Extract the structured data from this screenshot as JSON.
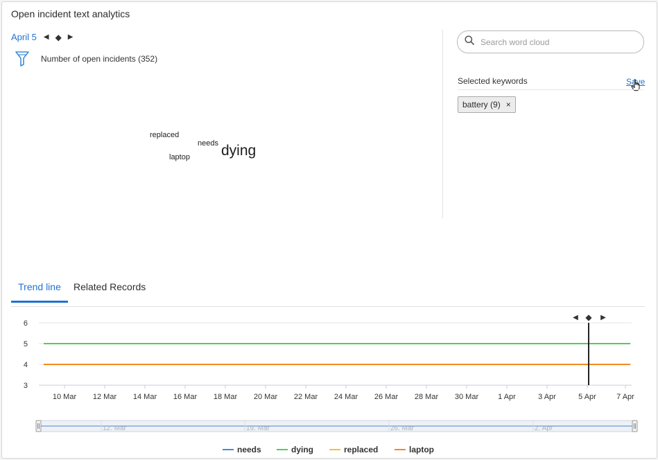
{
  "panel": {
    "title": "Open incident text analytics"
  },
  "date_nav": {
    "label": "April 5",
    "prev_glyph": "◀",
    "center_glyph": "◆",
    "next_glyph": "▶"
  },
  "filter": {
    "label": "Number of open incidents (352)",
    "icon": "filter-icon"
  },
  "word_cloud": {
    "words": {
      "replaced": "replaced",
      "needs": "needs",
      "laptop": "laptop",
      "dying": "dying"
    }
  },
  "search": {
    "placeholder": "Search word cloud",
    "value": ""
  },
  "keywords": {
    "label": "Selected keywords",
    "save_label": "Save",
    "chips": [
      {
        "label": "battery (9)",
        "remove_glyph": "×"
      }
    ]
  },
  "tabs": [
    {
      "label": "Trend line"
    },
    {
      "label": "Related Records"
    }
  ],
  "colors": {
    "accent": "#1f73d1",
    "needs": "#3e8ed8",
    "dying": "#4fcf4f",
    "replaced": "#f7c21c",
    "laptop": "#f28a1e"
  },
  "chart_data": {
    "type": "line",
    "x_tick_labels": [
      "10 Mar",
      "12 Mar",
      "14 Mar",
      "16 Mar",
      "18 Mar",
      "20 Mar",
      "22 Mar",
      "24 Mar",
      "26 Mar",
      "28 Mar",
      "30 Mar",
      "1 Apr",
      "3 Apr",
      "5 Apr",
      "7 Apr"
    ],
    "xlim": [
      "2024-03-08",
      "2024-04-07"
    ],
    "ylim": [
      3,
      6
    ],
    "y_ticks": [
      3,
      4,
      5,
      6
    ],
    "marker_date": "5 Apr",
    "marker_controls": {
      "prev": "◀",
      "center": "◆",
      "next": "▶"
    },
    "series": [
      {
        "name": "needs",
        "color": "#3e8ed8",
        "values": []
      },
      {
        "name": "dying",
        "color": "#4fcf4f",
        "values": [
          [
            "2024-03-08",
            5
          ],
          [
            "2024-04-07",
            5
          ]
        ]
      },
      {
        "name": "replaced",
        "color": "#f7c21c",
        "values": []
      },
      {
        "name": "laptop",
        "color": "#f28a1e",
        "values": [
          [
            "2024-03-08",
            4
          ],
          [
            "2024-04-07",
            4
          ]
        ]
      }
    ],
    "navigator": {
      "labels": [
        "12. Mar",
        "19. Mar",
        "26. Mar",
        "2. Apr"
      ]
    },
    "legend": [
      "needs",
      "dying",
      "replaced",
      "laptop"
    ],
    "legend_position": "bottom"
  }
}
